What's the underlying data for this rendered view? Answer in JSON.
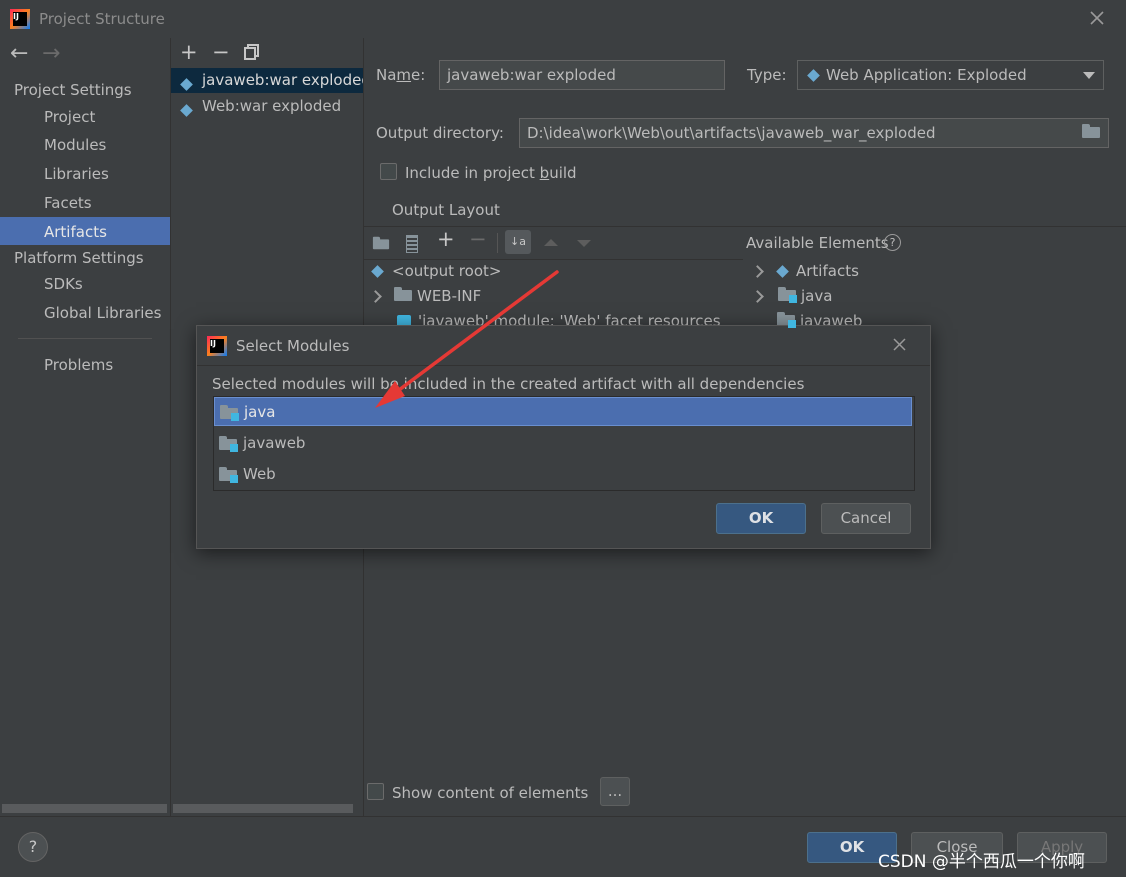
{
  "window": {
    "title": "Project Structure"
  },
  "nav": {
    "back_glyph": "←",
    "forward_glyph": "→",
    "sections": [
      {
        "header": "Project Settings",
        "items": [
          "Project",
          "Modules",
          "Libraries",
          "Facets",
          "Artifacts"
        ]
      },
      {
        "header": "Platform Settings",
        "items": [
          "SDKs",
          "Global Libraries"
        ]
      }
    ],
    "problems": "Problems",
    "selected": "Artifacts"
  },
  "artifact_list": {
    "toolbar": {
      "add": "+",
      "remove": "−",
      "copy_icon": "copy-icon"
    },
    "items": [
      "javaweb:war exploded",
      "Web:war exploded"
    ],
    "selected_index": 0
  },
  "details": {
    "name_label_pre": "Na",
    "name_label_ul": "m",
    "name_label_post": "e:",
    "name_value": "javaweb:war exploded",
    "type_label": "Type:",
    "type_value": "Web Application: Exploded",
    "output_dir_label": "Output directory:",
    "output_dir_value": "D:\\idea\\work\\Web\\out\\artifacts\\javaweb_war_exploded",
    "include_label_pre": "Include in project ",
    "include_label_ul": "b",
    "include_label_post": "uild",
    "include_checked": false,
    "output_layout_title": "Output Layout",
    "available_elements": "Available Elements",
    "help_glyph": "?",
    "layout_tree": [
      "<output root>",
      "WEB-INF",
      "'javaweb' module: 'Web' facet resources"
    ],
    "available_tree": [
      "Artifacts",
      "java",
      "javaweb"
    ],
    "show_content_label": "Show content of elements",
    "ellipsis_label": "..."
  },
  "footer": {
    "help_glyph": "?",
    "ok": "OK",
    "close": "Close",
    "apply": "Apply"
  },
  "watermark": "CSDN @半个西瓜一个你啊",
  "dialog": {
    "title": "Select Modules",
    "close_glyph": "✕",
    "description": "Selected modules will be included in the created artifact with all dependencies",
    "modules": [
      "java",
      "javaweb",
      "Web"
    ],
    "selected_index": 0,
    "ok": "OK",
    "cancel": "Cancel"
  },
  "colors": {
    "background": "#3c3f41",
    "selection": "#4b6eaf",
    "accent_arrow": "#e53935",
    "primary_button": "#365880"
  }
}
